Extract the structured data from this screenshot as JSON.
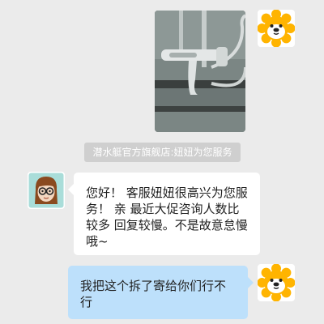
{
  "messages": [
    {
      "type": "image",
      "sender": "user",
      "avatar_icon": "lion-logo-icon",
      "image_subject": "faucet-photo"
    },
    {
      "type": "system",
      "text": "潜水艇官方旗舰店:妞妞为您服务"
    },
    {
      "type": "text",
      "sender": "agent",
      "avatar_icon": "girl-glasses-avatar-icon",
      "text": "您好！ 客服妞妞很高兴为您服务！ 亲 最近大促咨询人数比较多 回复较慢。不是故意怠慢哦~"
    },
    {
      "type": "text",
      "sender": "user",
      "avatar_icon": "lion-logo-icon",
      "text": "我把这个拆了寄给你们行不行"
    }
  ],
  "colors": {
    "background": "#ebebeb",
    "agent_bubble": "#ffffff",
    "user_bubble": "#bde0fb",
    "system_notice": "#cfcfcf",
    "lion_orange": "#ffb400"
  }
}
